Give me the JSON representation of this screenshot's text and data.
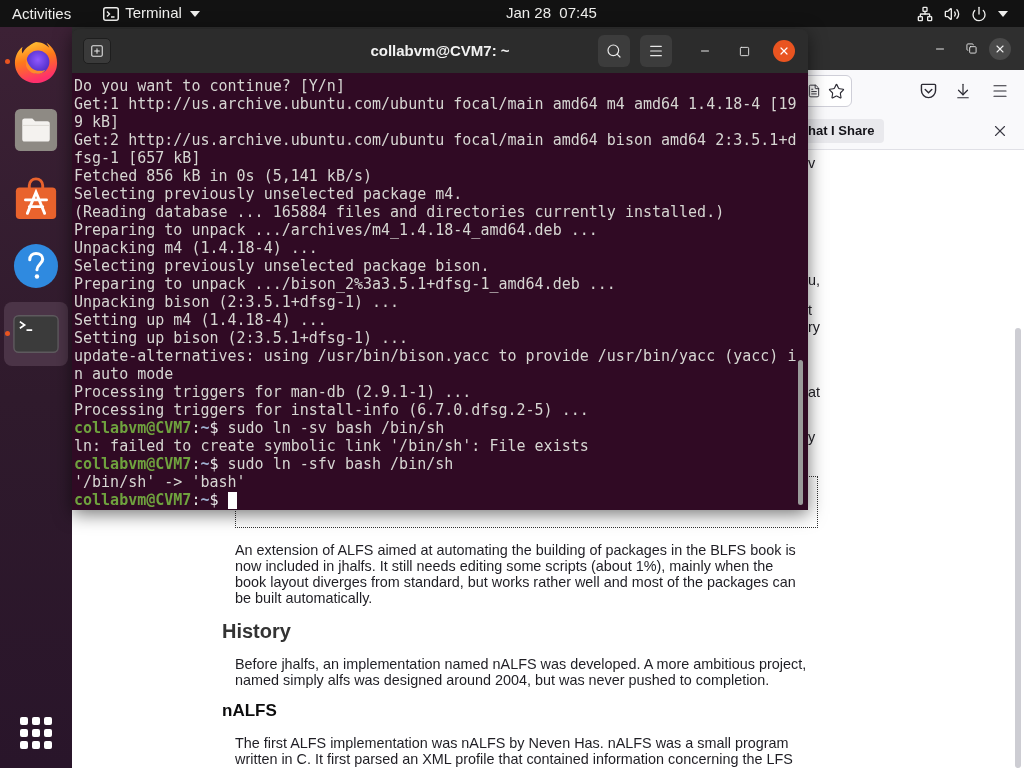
{
  "top_bar": {
    "activities": "Activities",
    "app_menu": "Terminal",
    "clock": "Jan 28  07:45"
  },
  "dock": {
    "items": [
      {
        "kind": "browser",
        "running": true,
        "selected": false
      },
      {
        "kind": "files",
        "running": false,
        "selected": false
      },
      {
        "kind": "software",
        "running": false,
        "selected": false
      },
      {
        "kind": "help",
        "running": false,
        "selected": false
      },
      {
        "kind": "terminal",
        "running": true,
        "selected": true
      }
    ]
  },
  "terminal": {
    "title": "collabvm@CVM7: ~",
    "lines": [
      {
        "kind": "output",
        "text": "Do you want to continue? [Y/n]"
      },
      {
        "kind": "output",
        "text": "Get:1 http://us.archive.ubuntu.com/ubuntu focal/main amd64 m4 amd64 1.4.18-4 [19"
      },
      {
        "kind": "output",
        "text": "9 kB]"
      },
      {
        "kind": "output",
        "text": "Get:2 http://us.archive.ubuntu.com/ubuntu focal/main amd64 bison amd64 2:3.5.1+d"
      },
      {
        "kind": "output",
        "text": "fsg-1 [657 kB]"
      },
      {
        "kind": "output",
        "text": "Fetched 856 kB in 0s (5,141 kB/s)"
      },
      {
        "kind": "output",
        "text": "Selecting previously unselected package m4."
      },
      {
        "kind": "output",
        "text": "(Reading database ... 165884 files and directories currently installed.)"
      },
      {
        "kind": "output",
        "text": "Preparing to unpack .../archives/m4_1.4.18-4_amd64.deb ..."
      },
      {
        "kind": "output",
        "text": "Unpacking m4 (1.4.18-4) ..."
      },
      {
        "kind": "output",
        "text": "Selecting previously unselected package bison."
      },
      {
        "kind": "output",
        "text": "Preparing to unpack .../bison_2%3a3.5.1+dfsg-1_amd64.deb ..."
      },
      {
        "kind": "output",
        "text": "Unpacking bison (2:3.5.1+dfsg-1) ..."
      },
      {
        "kind": "output",
        "text": "Setting up m4 (1.4.18-4) ..."
      },
      {
        "kind": "output",
        "text": "Setting up bison (2:3.5.1+dfsg-1) ..."
      },
      {
        "kind": "output",
        "text": "update-alternatives: using /usr/bin/bison.yacc to provide /usr/bin/yacc (yacc) i"
      },
      {
        "kind": "output",
        "text": "n auto mode"
      },
      {
        "kind": "output",
        "text": "Processing triggers for man-db (2.9.1-1) ..."
      },
      {
        "kind": "output",
        "text": "Processing triggers for install-info (6.7.0.dfsg.2-5) ..."
      },
      {
        "kind": "prompt",
        "user": "collabvm@CVM7",
        "separator": ":",
        "path": "~",
        "symbol": "$",
        "command": "sudo ln -sv bash /bin/sh",
        "cursor": false
      },
      {
        "kind": "output",
        "text": "ln: failed to create symbolic link '/bin/sh': File exists"
      },
      {
        "kind": "prompt",
        "user": "collabvm@CVM7",
        "separator": ":",
        "path": "~",
        "symbol": "$",
        "command": "sudo ln -sfv bash /bin/sh",
        "cursor": false
      },
      {
        "kind": "output",
        "text": "'/bin/sh' -> 'bash'"
      },
      {
        "kind": "prompt",
        "user": "collabvm@CVM7",
        "separator": ":",
        "path": "~",
        "symbol": "$",
        "cursor": true
      }
    ]
  },
  "browser": {
    "notification": {
      "button": "hat I Share"
    },
    "page": {
      "cut_line_ends": [
        "v",
        "u,",
        "t",
        "ry",
        "at",
        "y"
      ],
      "blocks": [
        {
          "kind": "paragraph",
          "lines": [
            "An extension of ALFS aimed at automating the building of packages in the BLFS book is",
            "now included in jhalfs. It still needs editing some scripts (about 1%), mainly when the",
            "book layout diverges from standard, but works rather well and most of the packages can",
            "be built automatically."
          ]
        },
        {
          "kind": "heading",
          "text": "History"
        },
        {
          "kind": "paragraph",
          "lines": [
            "Before jhalfs, an implementation named nALFS was developed. A more ambitious project,",
            "named simply alfs was designed around 2004, but was never pushed to completion."
          ]
        },
        {
          "kind": "subheading",
          "text": "nALFS"
        },
        {
          "kind": "paragraph",
          "lines": [
            "The first ALFS implementation was nALFS by Neven Has. nALFS was a small program",
            "written in C. It first parsed an XML profile that contained information concerning the LFS"
          ]
        }
      ]
    }
  }
}
